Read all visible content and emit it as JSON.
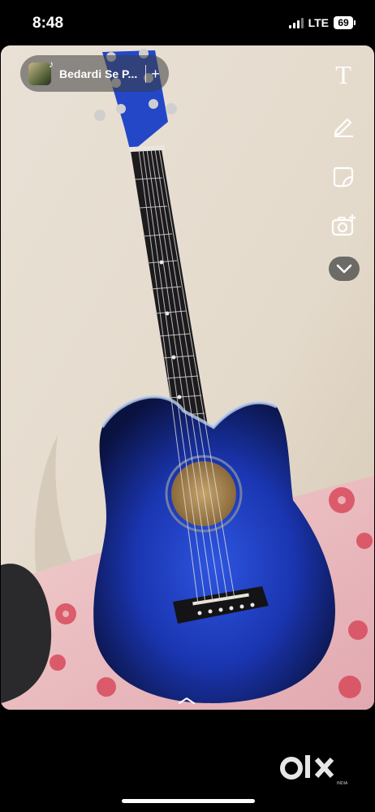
{
  "status_bar": {
    "time": "8:48",
    "network": "LTE",
    "battery": "69"
  },
  "story": {
    "music_sticker": {
      "song_title": "Bedardi Se P...",
      "add_symbol": "+",
      "icon": "music-note-icon"
    },
    "toolbar": {
      "text_tool_label": "T",
      "items": [
        "text-tool",
        "pencil-icon",
        "sticker-icon",
        "camera-plus-icon",
        "chevron-down-icon"
      ]
    }
  },
  "colors": {
    "wall": "#e6ddd0",
    "guitar_blue": "#1f3fb8",
    "bedsheet_pink": "#e9b7bd"
  },
  "watermark": {
    "brand": "OLX",
    "sub": "INDIA"
  }
}
